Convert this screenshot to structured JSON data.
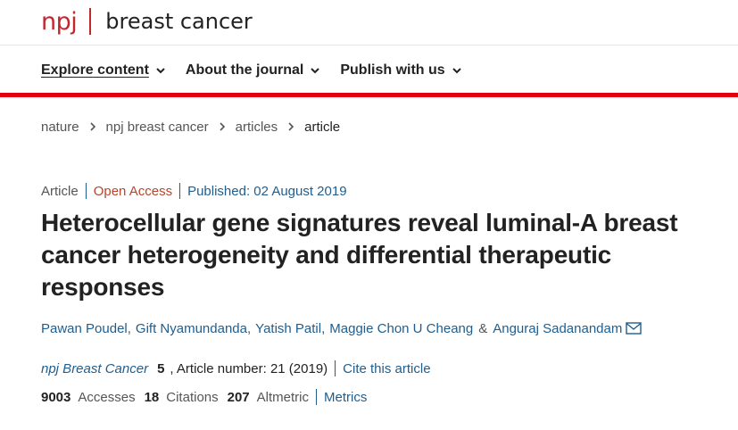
{
  "brand": {
    "logo": "npj",
    "journal": "breast cancer"
  },
  "nav": {
    "items": [
      {
        "label": "Explore content",
        "icon": "chevron-down-icon"
      },
      {
        "label": "About the journal",
        "icon": "chevron-down-icon"
      },
      {
        "label": "Publish with us",
        "icon": "chevron-down-icon"
      }
    ]
  },
  "breadcrumb": [
    "nature",
    "npj breast cancer",
    "articles",
    "article"
  ],
  "article": {
    "type": "Article",
    "access": "Open Access",
    "published": "Published: 02 August 2019",
    "title": "Heterocellular gene signatures reveal luminal-A breast cancer heterogeneity and differential therapeutic responses",
    "authors": [
      "Pawan Poudel",
      "Gift Nyamundanda",
      "Yatish Patil",
      "Maggie Chon U Cheang",
      "Anguraj Sadanandam"
    ],
    "author_separator": ",",
    "author_and": "&",
    "journal": "npj Breast Cancer",
    "volume": "5",
    "article_number": ", Article number: 21 (2019)",
    "cite_label": "Cite this article"
  },
  "metrics": {
    "accesses_value": "9003",
    "accesses_label": "Accesses",
    "citations_value": "18",
    "citations_label": "Citations",
    "altmetric_value": "207",
    "altmetric_label": "Altmetric",
    "metrics_link": "Metrics"
  },
  "colors": {
    "brand_red": "#c1272d",
    "bar_red": "#e4000f",
    "link_blue": "#1f5e8e",
    "open_access": "#b5472b"
  }
}
